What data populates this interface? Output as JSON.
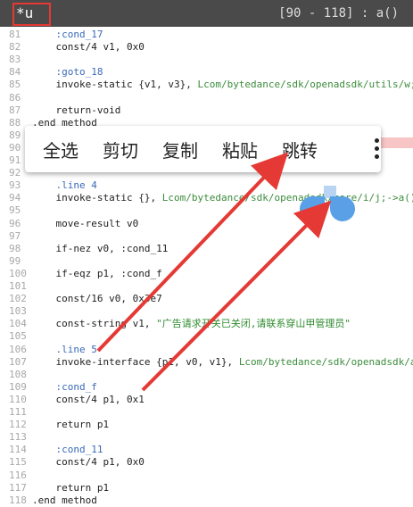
{
  "header": {
    "tab_title": "*u",
    "range_label": "[90 - 118] : a()"
  },
  "popup": {
    "items": [
      "全选",
      "剪切",
      "复制",
      "粘贴",
      "跳转"
    ],
    "more_icon": "more-vert-icon"
  },
  "code_lines": [
    {
      "n": "81",
      "pre": "    ",
      "t": ":cond_17",
      "cls": "lbl"
    },
    {
      "n": "82",
      "pre": "    ",
      "t": "const/4 v1, 0x0"
    },
    {
      "n": "83",
      "pre": "",
      "t": ""
    },
    {
      "n": "84",
      "pre": "    ",
      "t": ":goto_18",
      "cls": "lbl"
    },
    {
      "n": "85",
      "pre": "    ",
      "t": "invoke-static {v1, v3}, ",
      "path": "Lcom/bytedance/sdk/openadsdk/utils/w;->a(ZLjava/la"
    },
    {
      "n": "86",
      "pre": "",
      "t": ""
    },
    {
      "n": "87",
      "pre": "    ",
      "t": "return-void"
    },
    {
      "n": "88",
      "pre": "",
      "t": ".end method"
    },
    {
      "n": "89",
      "pre": "",
      "t": ""
    },
    {
      "n": "90",
      "pre": "",
      "t": ""
    },
    {
      "n": "91",
      "pre": "",
      "t": ""
    },
    {
      "n": "92",
      "pre": "",
      "t": ""
    },
    {
      "n": "93",
      "pre": "    ",
      "t": ".line 4",
      "cls": "lbl"
    },
    {
      "n": "94",
      "pre": "    ",
      "t": "invoke-static {}, ",
      "path": "Lcom/bytedance/sdk/openadsdk/core/i/j;->a()Z"
    },
    {
      "n": "95",
      "pre": "",
      "t": ""
    },
    {
      "n": "96",
      "pre": "    ",
      "t": "move-result v0"
    },
    {
      "n": "97",
      "pre": "",
      "t": ""
    },
    {
      "n": "98",
      "pre": "    ",
      "t": "if-nez v0, :cond_11"
    },
    {
      "n": "99",
      "pre": "",
      "t": ""
    },
    {
      "n": "100",
      "pre": "    ",
      "t": "if-eqz p1, :cond_f"
    },
    {
      "n": "101",
      "pre": "",
      "t": ""
    },
    {
      "n": "102",
      "pre": "    ",
      "t": "const/16 v0, 0x3e7"
    },
    {
      "n": "103",
      "pre": "",
      "t": ""
    },
    {
      "n": "104",
      "pre": "    ",
      "t": "const-string v1, ",
      "str": "\"广告请求开关已关闭,请联系穿山甲管理员\""
    },
    {
      "n": "105",
      "pre": "",
      "t": ""
    },
    {
      "n": "106",
      "pre": "    ",
      "t": ".line 5",
      "cls": "lbl"
    },
    {
      "n": "107",
      "pre": "    ",
      "t": "invoke-interface {p1, v0, v1}, ",
      "path": "Lcom/bytedance/sdk/openadsdk/a/b;->onError"
    },
    {
      "n": "108",
      "pre": "",
      "t": ""
    },
    {
      "n": "109",
      "pre": "    ",
      "t": ":cond_f",
      "cls": "lbl"
    },
    {
      "n": "110",
      "pre": "    ",
      "t": "const/4 p1, 0x1"
    },
    {
      "n": "111",
      "pre": "",
      "t": ""
    },
    {
      "n": "112",
      "pre": "    ",
      "t": "return p1"
    },
    {
      "n": "113",
      "pre": "",
      "t": ""
    },
    {
      "n": "114",
      "pre": "    ",
      "t": ":cond_11",
      "cls": "lbl"
    },
    {
      "n": "115",
      "pre": "    ",
      "t": "const/4 p1, 0x0"
    },
    {
      "n": "116",
      "pre": "",
      "t": ""
    },
    {
      "n": "117",
      "pre": "    ",
      "t": "return p1"
    },
    {
      "n": "118",
      "pre": "",
      "t": ".end method"
    }
  ],
  "colors": {
    "title_bar": "#4a4a4a",
    "annotation_red": "#e53935",
    "selection_handle": "#5aa0e6"
  }
}
